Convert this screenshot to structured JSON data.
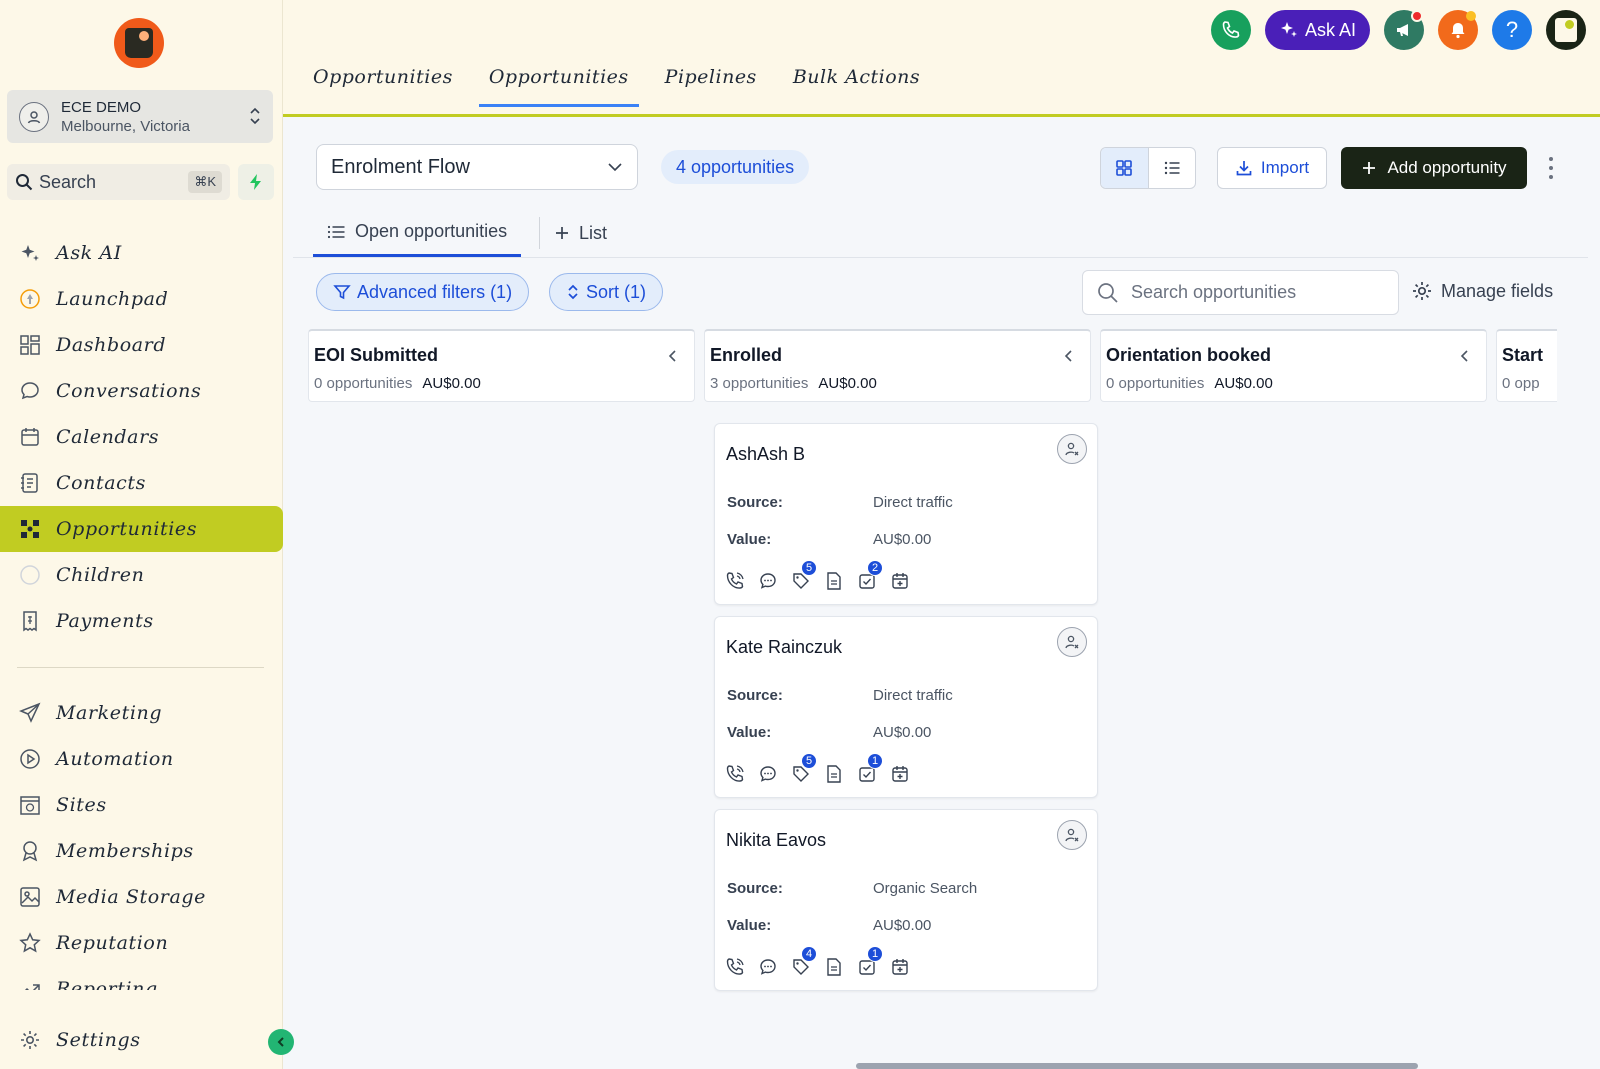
{
  "sidebar": {
    "account": {
      "name": "ECE DEMO",
      "location": "Melbourne, Victoria"
    },
    "search": {
      "label": "Search",
      "shortcut": "⌘K"
    },
    "items_top": [
      {
        "label": "Ask AI",
        "icon": "sparkle-icon"
      },
      {
        "label": "Launchpad",
        "icon": "rocket-icon"
      },
      {
        "label": "Dashboard",
        "icon": "grid-icon"
      },
      {
        "label": "Conversations",
        "icon": "chat-icon"
      },
      {
        "label": "Calendars",
        "icon": "calendar-icon"
      },
      {
        "label": "Contacts",
        "icon": "contact-book-icon"
      },
      {
        "label": "Opportunities",
        "icon": "opportunities-icon",
        "active": true
      },
      {
        "label": "Children",
        "icon": "smiley-icon"
      },
      {
        "label": "Payments",
        "icon": "receipt-icon"
      }
    ],
    "items_bottom": [
      {
        "label": "Marketing",
        "icon": "send-icon"
      },
      {
        "label": "Automation",
        "icon": "play-circle-icon"
      },
      {
        "label": "Sites",
        "icon": "globe-window-icon"
      },
      {
        "label": "Memberships",
        "icon": "award-icon"
      },
      {
        "label": "Media Storage",
        "icon": "image-icon"
      },
      {
        "label": "Reputation",
        "icon": "star-icon"
      },
      {
        "label": "Reporting",
        "icon": "trend-icon"
      }
    ],
    "settings_label": "Settings"
  },
  "topbar": {
    "tabs": [
      "Opportunities",
      "Opportunities",
      "Pipelines",
      "Bulk Actions"
    ],
    "active_tab": 1,
    "ask_ai_label": "Ask AI",
    "help_glyph": "?"
  },
  "main": {
    "pipeline": "Enrolment Flow",
    "count_label": "4 opportunities",
    "import_label": "Import",
    "add_label": "Add opportunity",
    "subtabs": {
      "open": "Open opportunities",
      "list": "List"
    },
    "filters": {
      "advanced": "Advanced filters (1)",
      "sort": "Sort (1)"
    },
    "search_placeholder": "Search opportunities",
    "manage_fields": "Manage fields"
  },
  "columns": [
    {
      "title": "EOI Submitted",
      "count": "0 opportunities",
      "value": "AU$0.00"
    },
    {
      "title": "Enrolled",
      "count": "3 opportunities",
      "value": "AU$0.00"
    },
    {
      "title": "Orientation booked",
      "count": "0 opportunities",
      "value": "AU$0.00"
    },
    {
      "title": "Start",
      "count": "0 opp",
      "value": ""
    }
  ],
  "cards": [
    {
      "name": "AshAsh B",
      "source_label": "Source:",
      "source": "Direct traffic",
      "value_label": "Value:",
      "value": "AU$0.00",
      "tags_badge": "5",
      "tasks_badge": "2"
    },
    {
      "name": "Kate Rainczuk",
      "source_label": "Source:",
      "source": "Direct traffic",
      "value_label": "Value:",
      "value": "AU$0.00",
      "tags_badge": "5",
      "tasks_badge": "1"
    },
    {
      "name": "Nikita Eavos",
      "source_label": "Source:",
      "source": "Organic Search",
      "value_label": "Value:",
      "value": "AU$0.00",
      "tags_badge": "4",
      "tasks_badge": "1"
    }
  ],
  "colors": {
    "accent": "#c1cc22",
    "primary": "#1d4ed8",
    "sidebar_bg": "#fdf8e8",
    "dark_button": "#1a2416",
    "ask_ai": "#4a1fb8"
  }
}
